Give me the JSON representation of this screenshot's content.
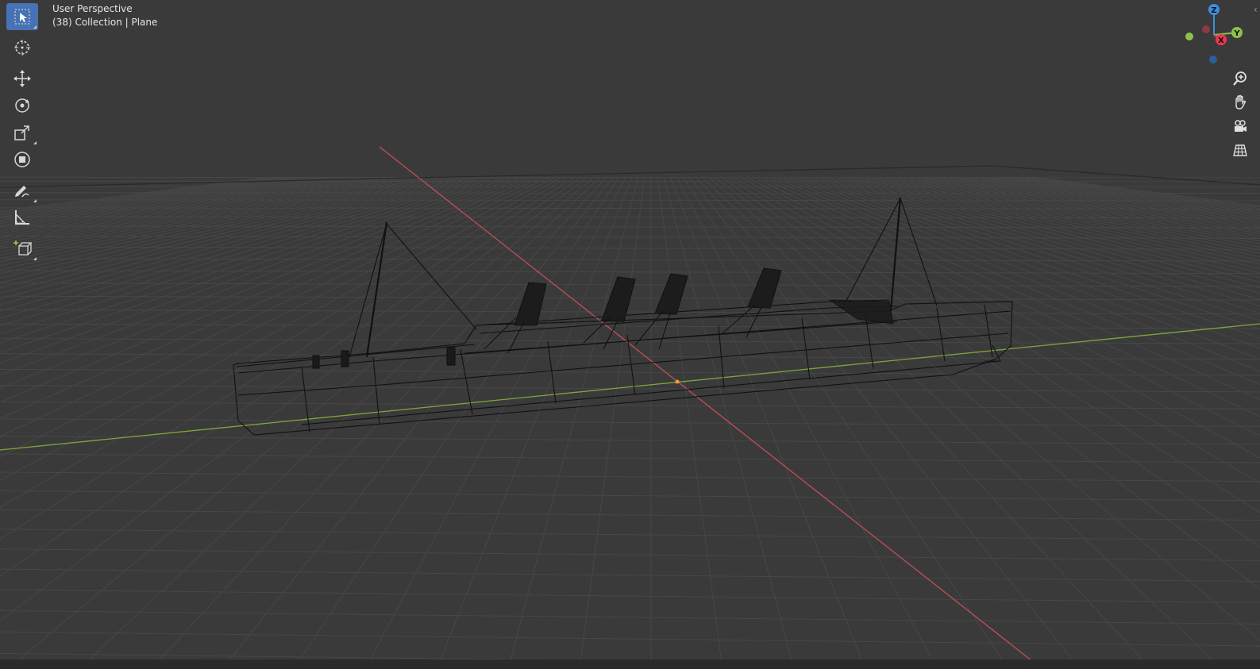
{
  "viewport": {
    "view_name": "User Perspective",
    "view_info": "(38) Collection | Plane"
  },
  "toolbar": {
    "tools": [
      {
        "name": "select-box",
        "icon": "select-box-icon",
        "active": true
      },
      {
        "name": "cursor",
        "icon": "cursor-icon",
        "active": false
      },
      {
        "name": "move",
        "icon": "move-icon",
        "active": false
      },
      {
        "name": "rotate",
        "icon": "rotate-icon",
        "active": false
      },
      {
        "name": "scale",
        "icon": "scale-icon",
        "active": false
      },
      {
        "name": "transform",
        "icon": "transform-icon",
        "active": false
      },
      {
        "name": "annotate",
        "icon": "annotate-icon",
        "active": false
      },
      {
        "name": "measure",
        "icon": "measure-icon",
        "active": false
      },
      {
        "name": "add-cube",
        "icon": "add-cube-icon",
        "active": false
      }
    ]
  },
  "gizmo": {
    "axis_x": "X",
    "axis_y": "Y",
    "axis_z": "Z",
    "colors": {
      "x": "#e8384f",
      "y": "#8bc34a",
      "z": "#3d8fe0"
    }
  },
  "navigation": {
    "buttons": [
      "zoom-icon",
      "pan-hand-icon",
      "camera-icon",
      "grid-ortho-icon"
    ]
  },
  "colors": {
    "background": "#3a3a3a",
    "grid": "#474747",
    "x_axis": "#c44d57",
    "y_axis": "#7fa63a",
    "wireframe": "#111111",
    "active_tool": "#4772b3"
  }
}
